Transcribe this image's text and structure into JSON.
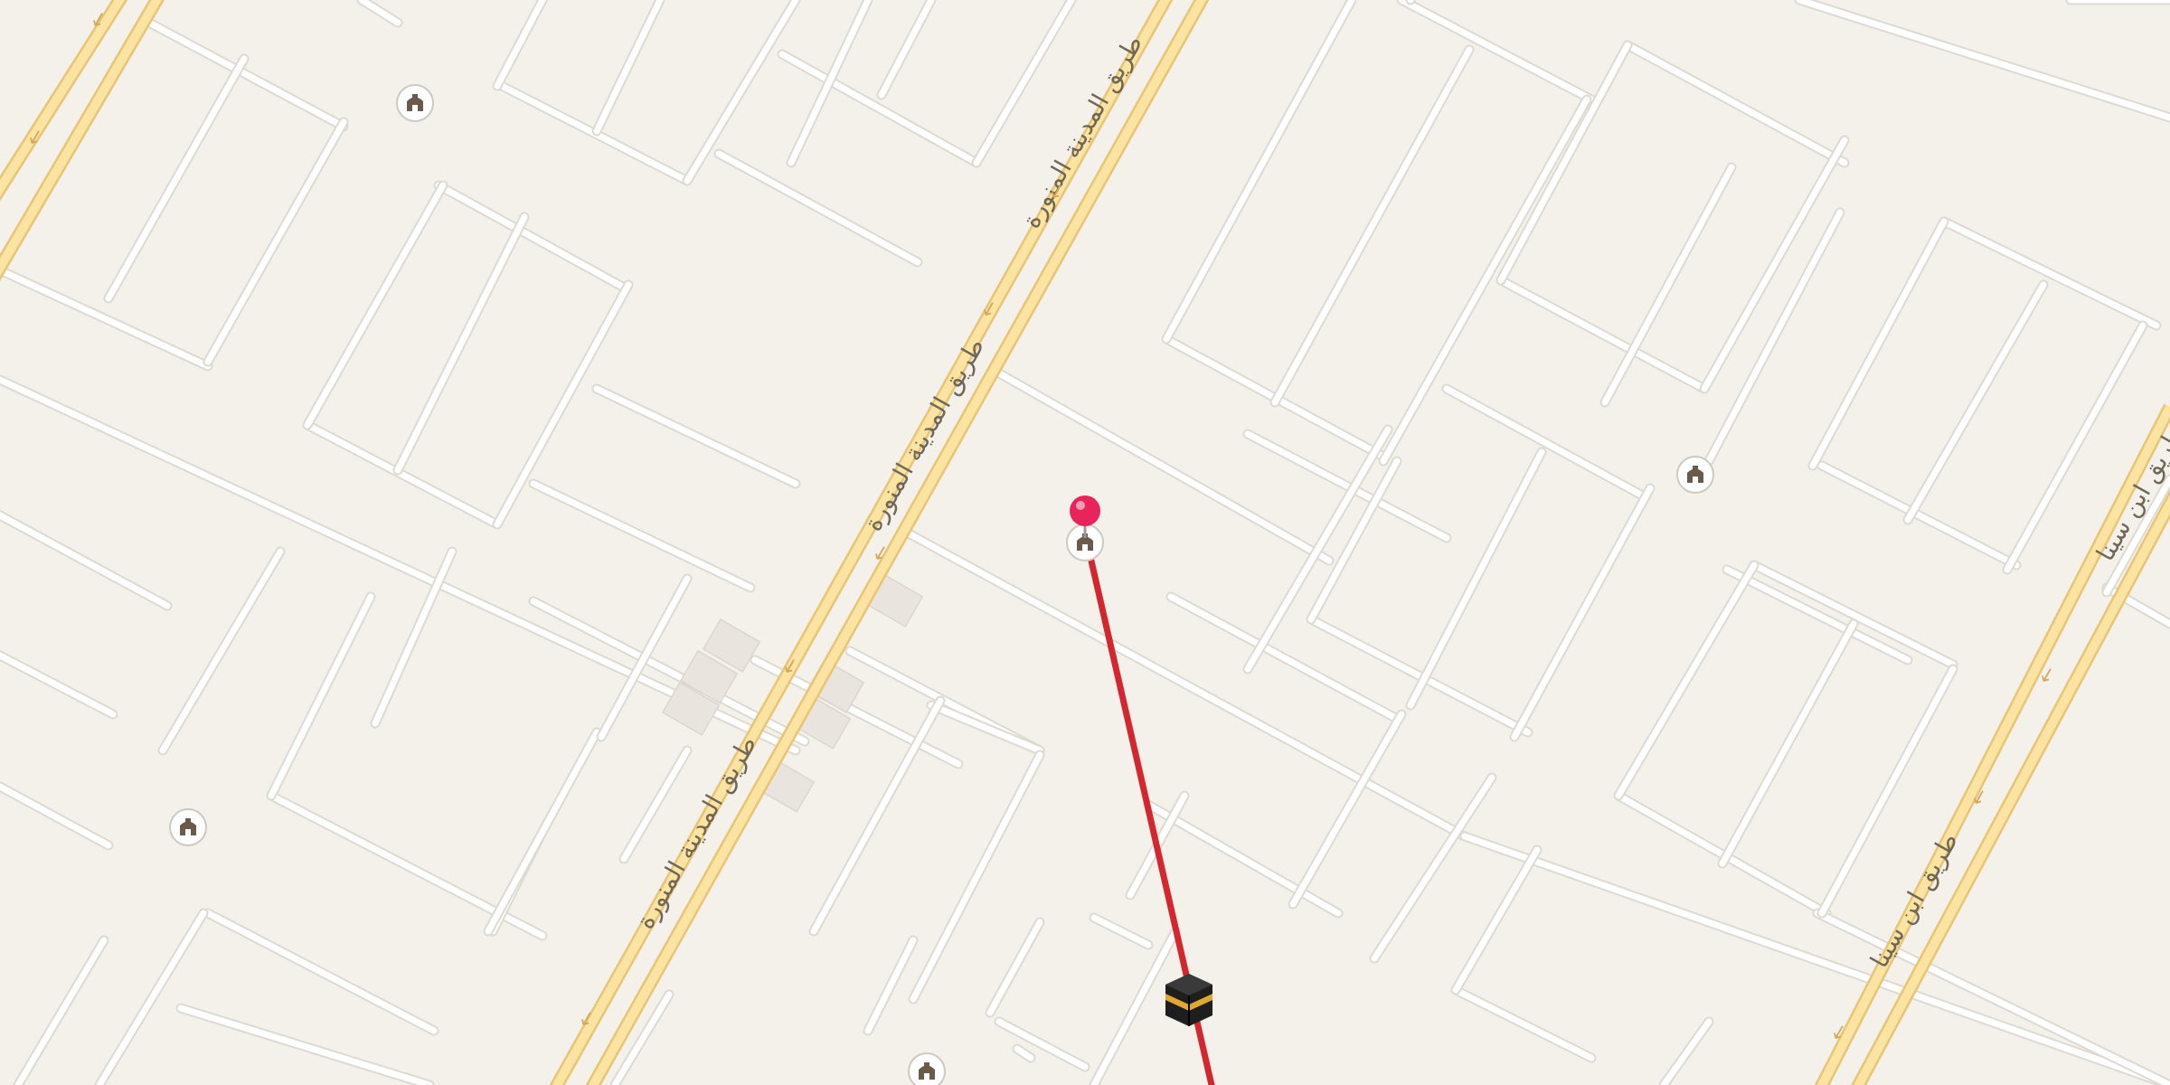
{
  "map": {
    "background_color": "#f3f1ea",
    "street_color": "#ffffff",
    "street_edge_color": "#dddad1",
    "highway_fill_color": "#fbe3a1",
    "highway_edge_color": "#e8c476",
    "building_color": "#e9e4de",
    "route_color": "#d3262e",
    "pin_color": "#e8245a"
  },
  "road_labels": [
    {
      "id": "road-label-madinah-1",
      "text": "طريق المدينة المنورة"
    },
    {
      "id": "road-label-madinah-2",
      "text": "طريق المدينة المنورة"
    },
    {
      "id": "road-label-madinah-3",
      "text": "طريق المدينة المنورة"
    },
    {
      "id": "road-label-ibn-sina",
      "text": "طريق ابن سينا"
    }
  ],
  "direction_arrow_glyph": "←",
  "icons": {
    "mosque": "mosque-icon",
    "pin": "location-pin-icon",
    "kaaba": "kaaba-icon"
  }
}
